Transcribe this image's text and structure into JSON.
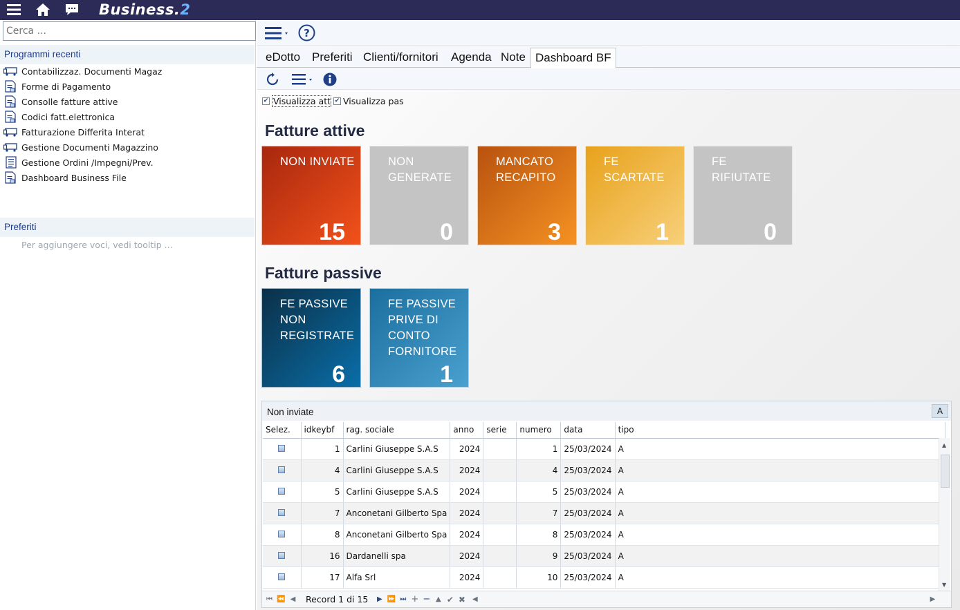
{
  "topbar": {
    "brand_main": "Business.",
    "brand_version": "2",
    "icons": [
      "menu-icon",
      "home-icon",
      "chat-icon"
    ]
  },
  "sidebar": {
    "search_placeholder": "Cerca ...",
    "recent_header": "Programmi recenti",
    "recent_items": [
      {
        "label": "Contabilizzaz. Documenti Magaz",
        "icon": "truck-icon"
      },
      {
        "label": "Forme di Pagamento",
        "icon": "document-icon"
      },
      {
        "label": "Consolle fatture attive",
        "icon": "document-icon"
      },
      {
        "label": "Codici fatt.elettronica",
        "icon": "document-icon"
      },
      {
        "label": "Fatturazione Differita Interat",
        "icon": "truck-icon"
      },
      {
        "label": "Gestione Documenti Magazzino",
        "icon": "truck-icon"
      },
      {
        "label": "Gestione Ordini /Impegni/Prev.",
        "icon": "list-icon"
      },
      {
        "label": "Dashboard Business File",
        "icon": "document-icon"
      }
    ],
    "favorites_header": "Preferiti",
    "favorites_hint": "Per aggiungere voci, vedi tooltip ..."
  },
  "tabs": [
    {
      "label": "eDotto",
      "active": false
    },
    {
      "label": "Preferiti",
      "active": false
    },
    {
      "label": "Clienti/fornitori",
      "active": false
    },
    {
      "label": "Agenda",
      "active": false
    },
    {
      "label": "Note",
      "active": false
    },
    {
      "label": "Dashboard BF",
      "active": true
    }
  ],
  "filters": {
    "show_active": {
      "label": "Visualizza attiv",
      "checked": true
    },
    "show_passive": {
      "label": "Visualizza pass",
      "checked": true
    }
  },
  "active_section": {
    "title": "Fatture attive",
    "tiles": [
      {
        "label": "NON INVIATE",
        "value": "15",
        "color_from": "#a8270e",
        "color_to": "#f2521a"
      },
      {
        "label": "NON GENERATE",
        "value": "0",
        "color_from": "#c4c4c4",
        "color_to": "#c4c4c4"
      },
      {
        "label": "MANCATO RECAPITO",
        "value": "3",
        "color_from": "#b8520f",
        "color_to": "#f59222"
      },
      {
        "label": "FE SCARTATE",
        "value": "1",
        "color_from": "#e8a21c",
        "color_to": "#f7d07a"
      },
      {
        "label": "FE RIFIUTATE",
        "value": "0",
        "color_from": "#c4c4c4",
        "color_to": "#c4c4c4"
      }
    ]
  },
  "passive_section": {
    "title": "Fatture passive",
    "tiles": [
      {
        "label": "FE PASSIVE NON REGISTRATE",
        "value": "6",
        "color_from": "#0b3048",
        "color_to": "#0a6ea8"
      },
      {
        "label": "FE PASSIVE PRIVE DI CONTO FORNITORE",
        "value": "1",
        "color_from": "#1a6f9e",
        "color_to": "#4aa0cf"
      }
    ]
  },
  "grid": {
    "title": "Non inviate",
    "a_button": "A",
    "columns": [
      "Selez.",
      "idkeybf",
      "rag. sociale",
      "anno",
      "serie",
      "numero",
      "data",
      "tipo"
    ],
    "rows": [
      {
        "idkeybf": "1",
        "rag_sociale": "Carlini Giuseppe S.A.S",
        "anno": "2024",
        "serie": "",
        "numero": "1",
        "data": "25/03/2024",
        "tipo": "A"
      },
      {
        "idkeybf": "4",
        "rag_sociale": "Carlini Giuseppe S.A.S",
        "anno": "2024",
        "serie": "",
        "numero": "4",
        "data": "25/03/2024",
        "tipo": "A"
      },
      {
        "idkeybf": "5",
        "rag_sociale": "Carlini Giuseppe S.A.S",
        "anno": "2024",
        "serie": "",
        "numero": "5",
        "data": "25/03/2024",
        "tipo": "A"
      },
      {
        "idkeybf": "7",
        "rag_sociale": "Anconetani Gilberto Spa",
        "anno": "2024",
        "serie": "",
        "numero": "7",
        "data": "25/03/2024",
        "tipo": "A"
      },
      {
        "idkeybf": "8",
        "rag_sociale": "Anconetani Gilberto Spa",
        "anno": "2024",
        "serie": "",
        "numero": "8",
        "data": "25/03/2024",
        "tipo": "A"
      },
      {
        "idkeybf": "16",
        "rag_sociale": "Dardanelli spa",
        "anno": "2024",
        "serie": "",
        "numero": "9",
        "data": "25/03/2024",
        "tipo": "A"
      },
      {
        "idkeybf": "17",
        "rag_sociale": "Alfa Srl",
        "anno": "2024",
        "serie": "",
        "numero": "10",
        "data": "25/03/2024",
        "tipo": "A"
      }
    ],
    "pager_text": "Record 1 di 15"
  }
}
